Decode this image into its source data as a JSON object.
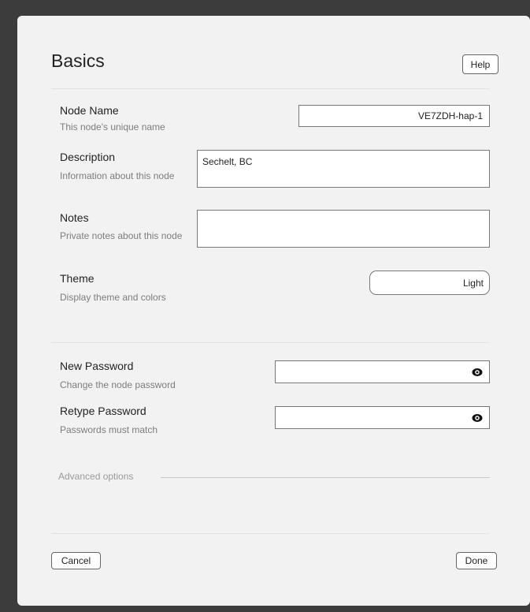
{
  "dialog": {
    "title": "Basics",
    "help_label": "Help",
    "cancel_label": "Cancel",
    "done_label": "Done"
  },
  "fields": {
    "node_name": {
      "label": "Node Name",
      "hint": "This node's unique name",
      "value": "VE7ZDH-hap-1"
    },
    "description": {
      "label": "Description",
      "hint": "Information about this node",
      "value": "Sechelt, BC"
    },
    "notes": {
      "label": "Notes",
      "hint": "Private notes about this node",
      "value": ""
    },
    "theme": {
      "label": "Theme",
      "hint": "Display theme and colors",
      "value": "Light"
    },
    "new_password": {
      "label": "New Password",
      "hint": "Change the node password",
      "value": ""
    },
    "retype_password": {
      "label": "Retype Password",
      "hint": "Passwords must match",
      "value": ""
    }
  },
  "advanced": {
    "label": "Advanced options"
  },
  "icons": {
    "password_toggle": "eye-icon"
  }
}
